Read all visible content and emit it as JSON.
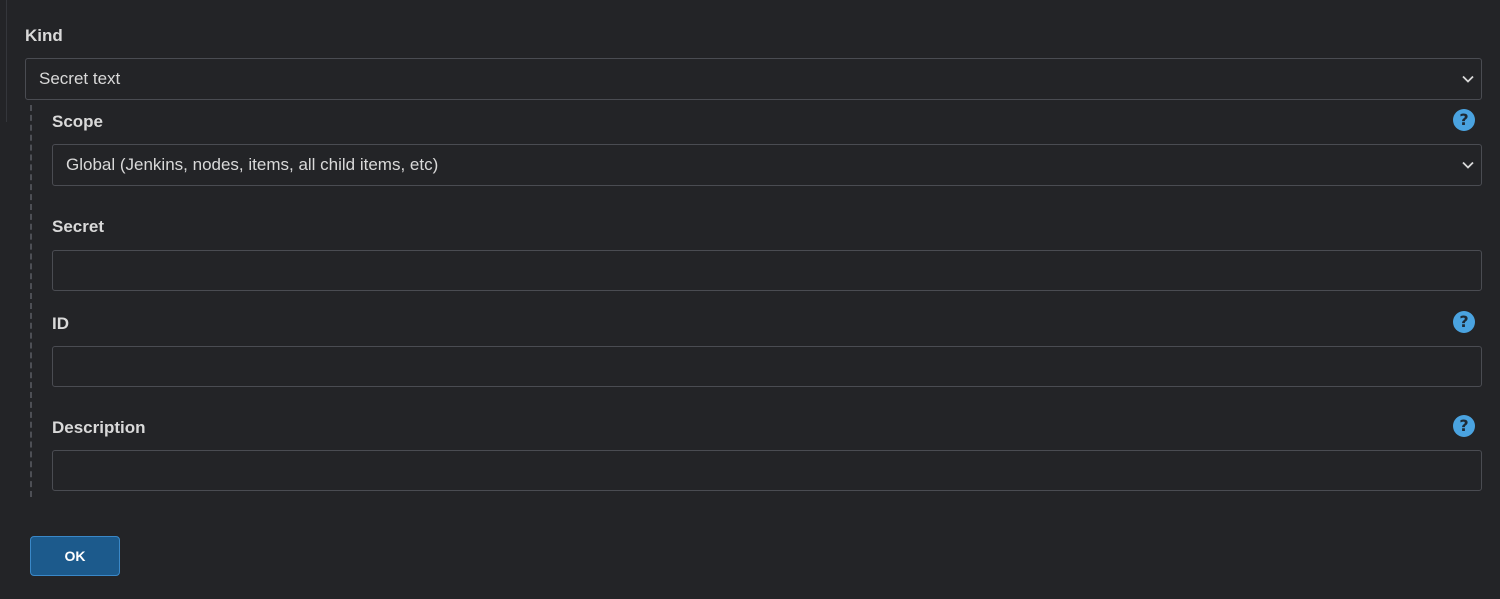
{
  "kind": {
    "label": "Kind",
    "selected": "Secret text"
  },
  "scope": {
    "label": "Scope",
    "selected": "Global (Jenkins, nodes, items, all child items, etc)",
    "help_glyph": "?"
  },
  "secret": {
    "label": "Secret",
    "value": ""
  },
  "id": {
    "label": "ID",
    "value": "",
    "help_glyph": "?"
  },
  "description": {
    "label": "Description",
    "value": "",
    "help_glyph": "?"
  },
  "actions": {
    "ok_label": "OK"
  },
  "colors": {
    "background": "#232427",
    "help_icon": "#4aa3e0",
    "ok_button": "#1c5a8c"
  }
}
